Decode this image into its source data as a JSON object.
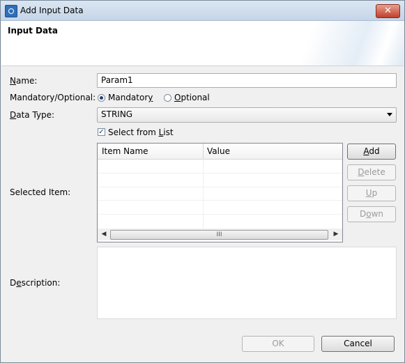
{
  "window": {
    "title": "Add Input Data",
    "close_glyph": "✕"
  },
  "header": {
    "title": "Input Data"
  },
  "form": {
    "name": {
      "label_pre": "",
      "label_u": "N",
      "label_post": "ame:",
      "value": "Param1"
    },
    "mandatory": {
      "label": "Mandatory/Optional:",
      "option_mandatory": {
        "pre": "Mandator",
        "u": "y",
        "post": ""
      },
      "option_optional": {
        "pre": "",
        "u": "O",
        "post": "ptional"
      },
      "selected": "Mandatory"
    },
    "data_type": {
      "label_pre": "",
      "label_u": "D",
      "label_post": "ata Type:",
      "value": "STRING"
    },
    "select_from_list": {
      "pre": "Select from ",
      "u": "L",
      "post": "ist",
      "checked": true
    },
    "selected_item": {
      "label": "Selected Item:",
      "columns": [
        "Item Name",
        "Value"
      ],
      "rows": [],
      "scroll_glyph": "III"
    },
    "description": {
      "label_pre": "D",
      "label_u": "e",
      "label_post": "scription:",
      "value": ""
    }
  },
  "side_buttons": {
    "add": {
      "pre": "",
      "u": "A",
      "post": "dd",
      "enabled": true
    },
    "delete": {
      "pre": "",
      "u": "D",
      "post": "elete",
      "enabled": false
    },
    "up": {
      "pre": "",
      "u": "U",
      "post": "p",
      "enabled": false
    },
    "down": {
      "pre": "D",
      "u": "o",
      "post": "wn",
      "enabled": false
    }
  },
  "footer": {
    "ok_label": "OK",
    "cancel_label": "Cancel",
    "ok_enabled": false
  },
  "icons": {
    "app": "app-icon",
    "close": "close-icon",
    "dropdown": "chevron-down-icon",
    "check": "checkmark-icon"
  }
}
